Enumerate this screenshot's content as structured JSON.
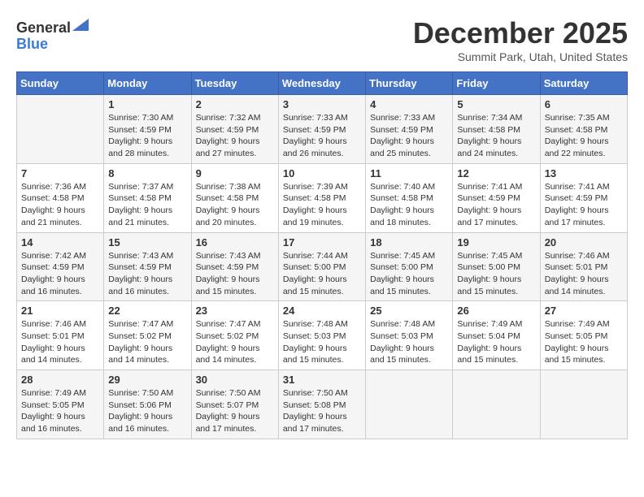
{
  "header": {
    "logo_line1": "General",
    "logo_line2": "Blue",
    "month_title": "December 2025",
    "location": "Summit Park, Utah, United States"
  },
  "weekdays": [
    "Sunday",
    "Monday",
    "Tuesday",
    "Wednesday",
    "Thursday",
    "Friday",
    "Saturday"
  ],
  "weeks": [
    [
      {
        "day": "",
        "sunrise": "",
        "sunset": "",
        "daylight": ""
      },
      {
        "day": "1",
        "sunrise": "Sunrise: 7:30 AM",
        "sunset": "Sunset: 4:59 PM",
        "daylight": "Daylight: 9 hours and 28 minutes."
      },
      {
        "day": "2",
        "sunrise": "Sunrise: 7:32 AM",
        "sunset": "Sunset: 4:59 PM",
        "daylight": "Daylight: 9 hours and 27 minutes."
      },
      {
        "day": "3",
        "sunrise": "Sunrise: 7:33 AM",
        "sunset": "Sunset: 4:59 PM",
        "daylight": "Daylight: 9 hours and 26 minutes."
      },
      {
        "day": "4",
        "sunrise": "Sunrise: 7:33 AM",
        "sunset": "Sunset: 4:59 PM",
        "daylight": "Daylight: 9 hours and 25 minutes."
      },
      {
        "day": "5",
        "sunrise": "Sunrise: 7:34 AM",
        "sunset": "Sunset: 4:58 PM",
        "daylight": "Daylight: 9 hours and 24 minutes."
      },
      {
        "day": "6",
        "sunrise": "Sunrise: 7:35 AM",
        "sunset": "Sunset: 4:58 PM",
        "daylight": "Daylight: 9 hours and 22 minutes."
      }
    ],
    [
      {
        "day": "7",
        "sunrise": "Sunrise: 7:36 AM",
        "sunset": "Sunset: 4:58 PM",
        "daylight": "Daylight: 9 hours and 21 minutes."
      },
      {
        "day": "8",
        "sunrise": "Sunrise: 7:37 AM",
        "sunset": "Sunset: 4:58 PM",
        "daylight": "Daylight: 9 hours and 21 minutes."
      },
      {
        "day": "9",
        "sunrise": "Sunrise: 7:38 AM",
        "sunset": "Sunset: 4:58 PM",
        "daylight": "Daylight: 9 hours and 20 minutes."
      },
      {
        "day": "10",
        "sunrise": "Sunrise: 7:39 AM",
        "sunset": "Sunset: 4:58 PM",
        "daylight": "Daylight: 9 hours and 19 minutes."
      },
      {
        "day": "11",
        "sunrise": "Sunrise: 7:40 AM",
        "sunset": "Sunset: 4:58 PM",
        "daylight": "Daylight: 9 hours and 18 minutes."
      },
      {
        "day": "12",
        "sunrise": "Sunrise: 7:41 AM",
        "sunset": "Sunset: 4:59 PM",
        "daylight": "Daylight: 9 hours and 17 minutes."
      },
      {
        "day": "13",
        "sunrise": "Sunrise: 7:41 AM",
        "sunset": "Sunset: 4:59 PM",
        "daylight": "Daylight: 9 hours and 17 minutes."
      }
    ],
    [
      {
        "day": "14",
        "sunrise": "Sunrise: 7:42 AM",
        "sunset": "Sunset: 4:59 PM",
        "daylight": "Daylight: 9 hours and 16 minutes."
      },
      {
        "day": "15",
        "sunrise": "Sunrise: 7:43 AM",
        "sunset": "Sunset: 4:59 PM",
        "daylight": "Daylight: 9 hours and 16 minutes."
      },
      {
        "day": "16",
        "sunrise": "Sunrise: 7:43 AM",
        "sunset": "Sunset: 4:59 PM",
        "daylight": "Daylight: 9 hours and 15 minutes."
      },
      {
        "day": "17",
        "sunrise": "Sunrise: 7:44 AM",
        "sunset": "Sunset: 5:00 PM",
        "daylight": "Daylight: 9 hours and 15 minutes."
      },
      {
        "day": "18",
        "sunrise": "Sunrise: 7:45 AM",
        "sunset": "Sunset: 5:00 PM",
        "daylight": "Daylight: 9 hours and 15 minutes."
      },
      {
        "day": "19",
        "sunrise": "Sunrise: 7:45 AM",
        "sunset": "Sunset: 5:00 PM",
        "daylight": "Daylight: 9 hours and 15 minutes."
      },
      {
        "day": "20",
        "sunrise": "Sunrise: 7:46 AM",
        "sunset": "Sunset: 5:01 PM",
        "daylight": "Daylight: 9 hours and 14 minutes."
      }
    ],
    [
      {
        "day": "21",
        "sunrise": "Sunrise: 7:46 AM",
        "sunset": "Sunset: 5:01 PM",
        "daylight": "Daylight: 9 hours and 14 minutes."
      },
      {
        "day": "22",
        "sunrise": "Sunrise: 7:47 AM",
        "sunset": "Sunset: 5:02 PM",
        "daylight": "Daylight: 9 hours and 14 minutes."
      },
      {
        "day": "23",
        "sunrise": "Sunrise: 7:47 AM",
        "sunset": "Sunset: 5:02 PM",
        "daylight": "Daylight: 9 hours and 14 minutes."
      },
      {
        "day": "24",
        "sunrise": "Sunrise: 7:48 AM",
        "sunset": "Sunset: 5:03 PM",
        "daylight": "Daylight: 9 hours and 15 minutes."
      },
      {
        "day": "25",
        "sunrise": "Sunrise: 7:48 AM",
        "sunset": "Sunset: 5:03 PM",
        "daylight": "Daylight: 9 hours and 15 minutes."
      },
      {
        "day": "26",
        "sunrise": "Sunrise: 7:49 AM",
        "sunset": "Sunset: 5:04 PM",
        "daylight": "Daylight: 9 hours and 15 minutes."
      },
      {
        "day": "27",
        "sunrise": "Sunrise: 7:49 AM",
        "sunset": "Sunset: 5:05 PM",
        "daylight": "Daylight: 9 hours and 15 minutes."
      }
    ],
    [
      {
        "day": "28",
        "sunrise": "Sunrise: 7:49 AM",
        "sunset": "Sunset: 5:05 PM",
        "daylight": "Daylight: 9 hours and 16 minutes."
      },
      {
        "day": "29",
        "sunrise": "Sunrise: 7:50 AM",
        "sunset": "Sunset: 5:06 PM",
        "daylight": "Daylight: 9 hours and 16 minutes."
      },
      {
        "day": "30",
        "sunrise": "Sunrise: 7:50 AM",
        "sunset": "Sunset: 5:07 PM",
        "daylight": "Daylight: 9 hours and 17 minutes."
      },
      {
        "day": "31",
        "sunrise": "Sunrise: 7:50 AM",
        "sunset": "Sunset: 5:08 PM",
        "daylight": "Daylight: 9 hours and 17 minutes."
      },
      {
        "day": "",
        "sunrise": "",
        "sunset": "",
        "daylight": ""
      },
      {
        "day": "",
        "sunrise": "",
        "sunset": "",
        "daylight": ""
      },
      {
        "day": "",
        "sunrise": "",
        "sunset": "",
        "daylight": ""
      }
    ]
  ]
}
